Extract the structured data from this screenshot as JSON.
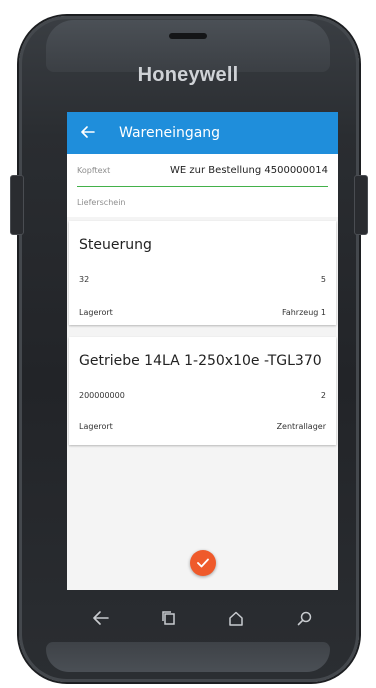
{
  "device": {
    "brand": "Honeywell"
  },
  "appbar": {
    "title": "Wareneingang",
    "back_icon": "arrow-left-icon"
  },
  "form": {
    "kopftext_label": "Kopftext",
    "kopftext_value": "WE zur Bestellung 4500000014",
    "lieferschein_label": "Lieferschein"
  },
  "items": [
    {
      "title": "Steuerung",
      "number": "32",
      "quantity": "5",
      "location_label": "Lagerort",
      "location_value": "Fahrzeug 1"
    },
    {
      "title": "Getriebe 14LA 1-250x10e -TGL370",
      "number": "200000000",
      "quantity": "2",
      "location_label": "Lagerort",
      "location_value": "Zentrallager"
    }
  ],
  "fab": {
    "icon": "check-icon",
    "color": "#ef5a2b"
  },
  "colors": {
    "appbar": "#1f8edb",
    "active_underline": "#43b14a"
  },
  "navbar": {
    "icons": [
      "back-icon",
      "recent-apps-icon",
      "home-icon",
      "search-icon"
    ]
  }
}
